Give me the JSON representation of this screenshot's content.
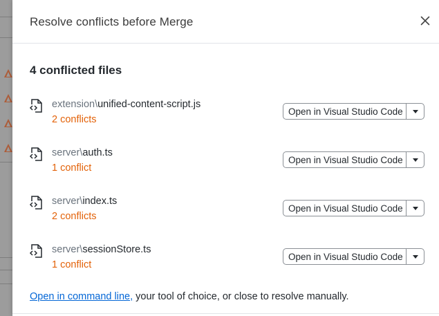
{
  "dialog": {
    "title": "Resolve conflicts before Merge",
    "conflict_count_label": "4 conflicted files",
    "files": [
      {
        "dir": "extension\\",
        "name": "unified-content-script.js",
        "conflicts": "2 conflicts",
        "button": "Open in Visual Studio Code"
      },
      {
        "dir": "server\\",
        "name": "auth.ts",
        "conflicts": "1 conflict",
        "button": "Open in Visual Studio Code"
      },
      {
        "dir": "server\\",
        "name": "index.ts",
        "conflicts": "2 conflicts",
        "button": "Open in Visual Studio Code"
      },
      {
        "dir": "server\\",
        "name": "sessionStore.ts",
        "conflicts": "1 conflict",
        "button": "Open in Visual Studio Code"
      }
    ],
    "footer": {
      "link": "Open in command line,",
      "text": " your tool of choice, or close to resolve manually."
    },
    "icons": {
      "close": "close-icon",
      "file": "file-code-icon",
      "dropdown": "triangle-down-icon"
    },
    "colors": {
      "conflict": "#e36209",
      "link": "#0366d6",
      "warning": "#b0562e"
    }
  }
}
